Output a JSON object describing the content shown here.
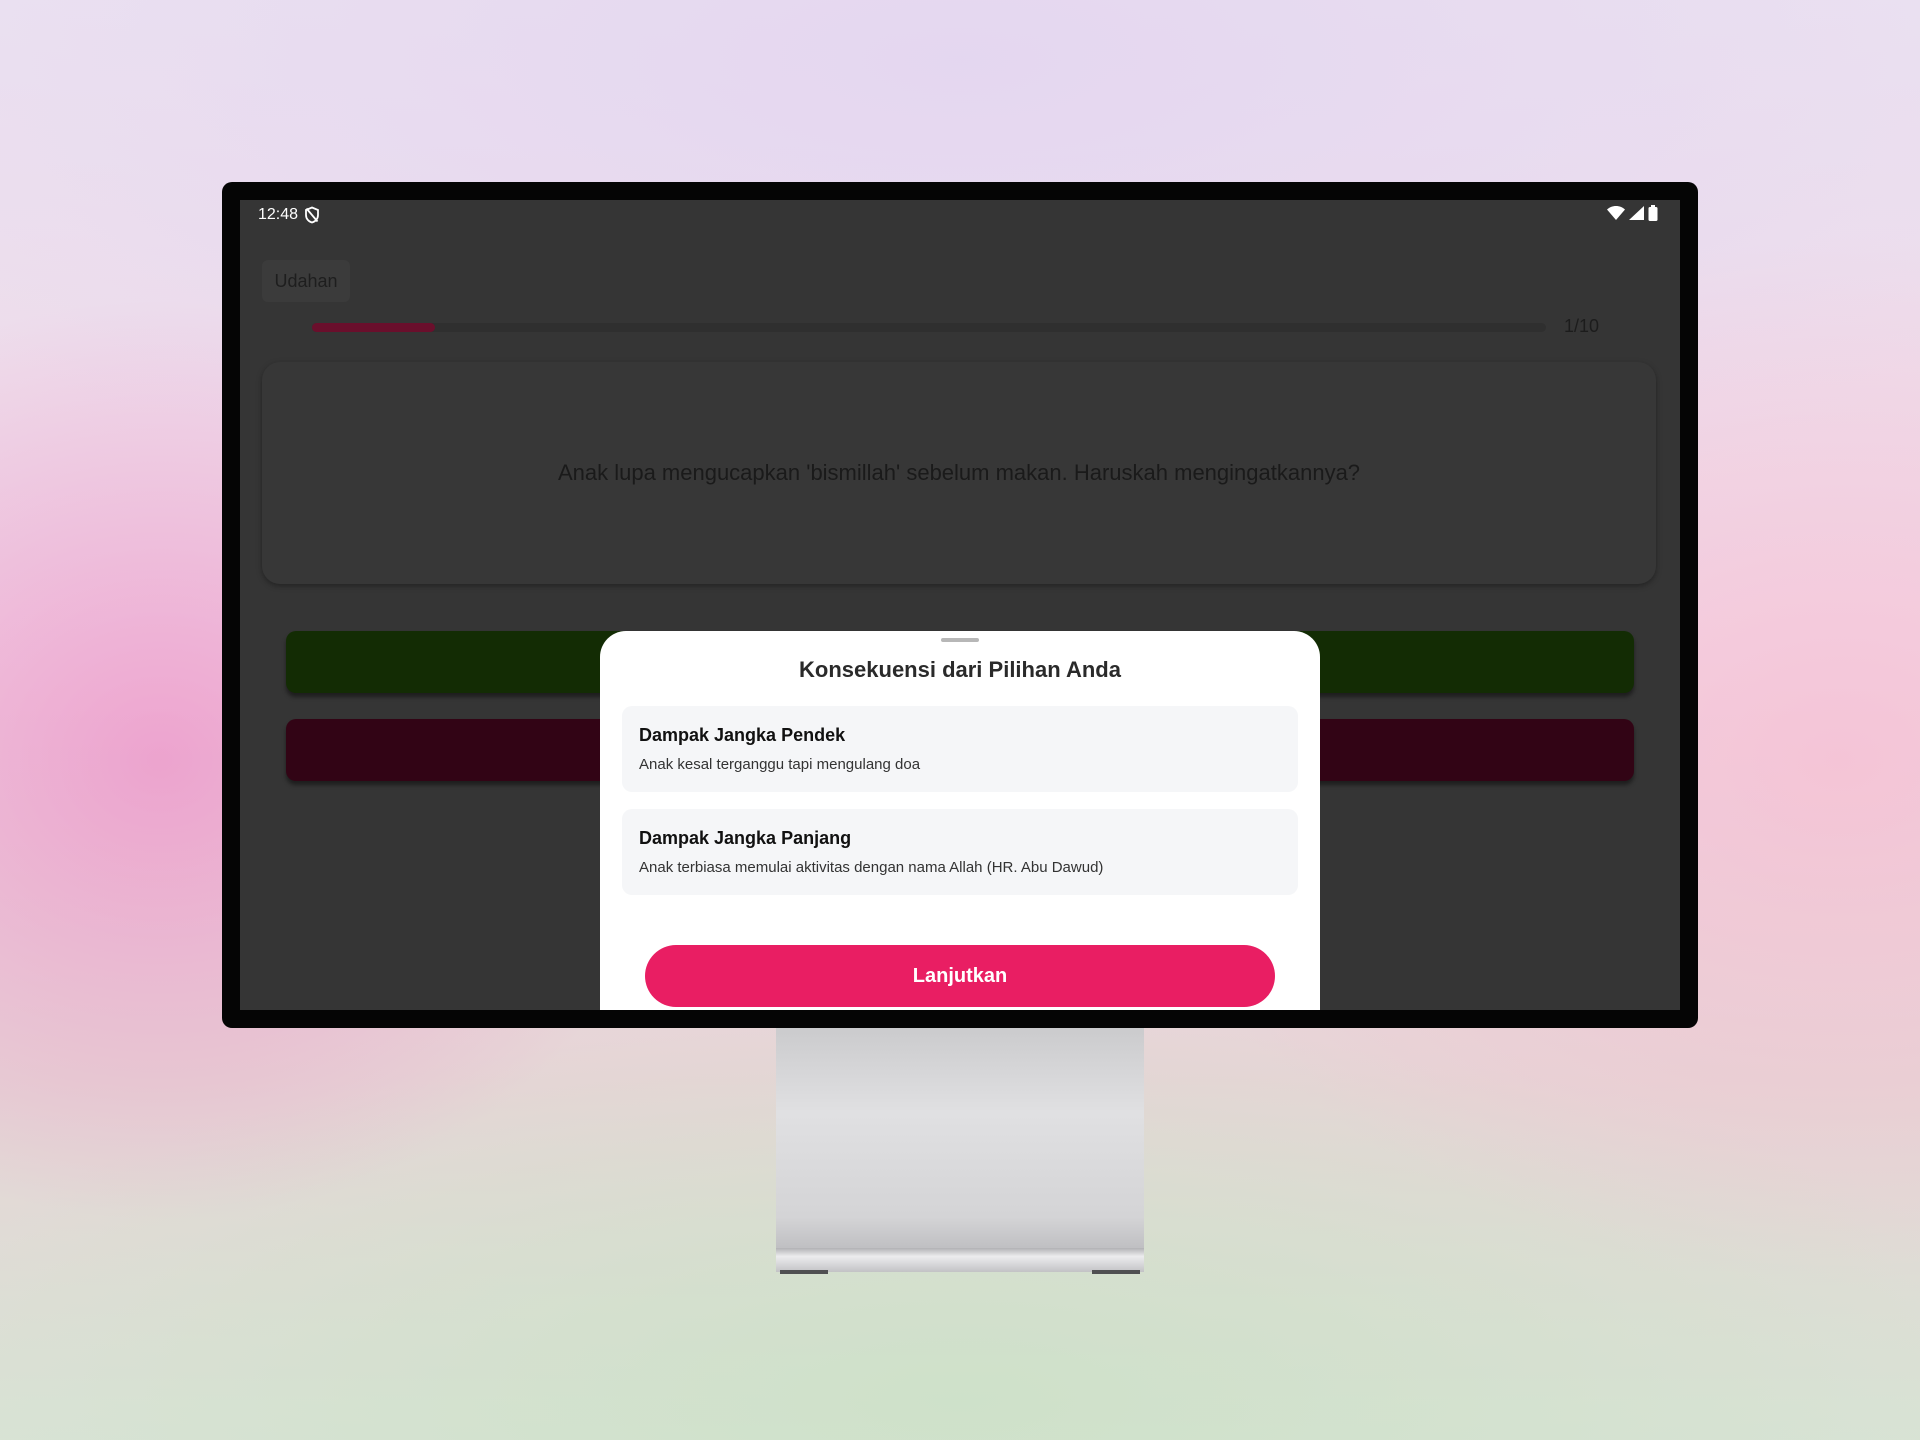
{
  "status_bar": {
    "time": "12:48",
    "left_icon": "shield-off-icon",
    "right_icons": [
      "wifi-icon",
      "cellular-signal-icon",
      "battery-icon"
    ]
  },
  "header": {
    "back_label": "Udahan"
  },
  "progress": {
    "current": 1,
    "total": 10,
    "fraction": 0.1,
    "label": "1/10",
    "fill_color": "#6a0f2c"
  },
  "question": {
    "text": "Anak lupa mengucapkan 'bismillah' sebelum makan. Haruskah mengingatkannya?"
  },
  "answers": {
    "yes_color": "#132c04",
    "no_color": "#320415"
  },
  "sheet": {
    "title": "Konsekuensi dari Pilihan Anda",
    "short_term": {
      "title": "Dampak Jangka Pendek",
      "description": "Anak kesal terganggu tapi mengulang doa"
    },
    "long_term": {
      "title": "Dampak Jangka Panjang",
      "description": "Anak terbiasa memulai aktivitas dengan nama Allah (HR. Abu Dawud)"
    },
    "continue_label": "Lanjutkan",
    "accent_color": "#e91e63"
  }
}
